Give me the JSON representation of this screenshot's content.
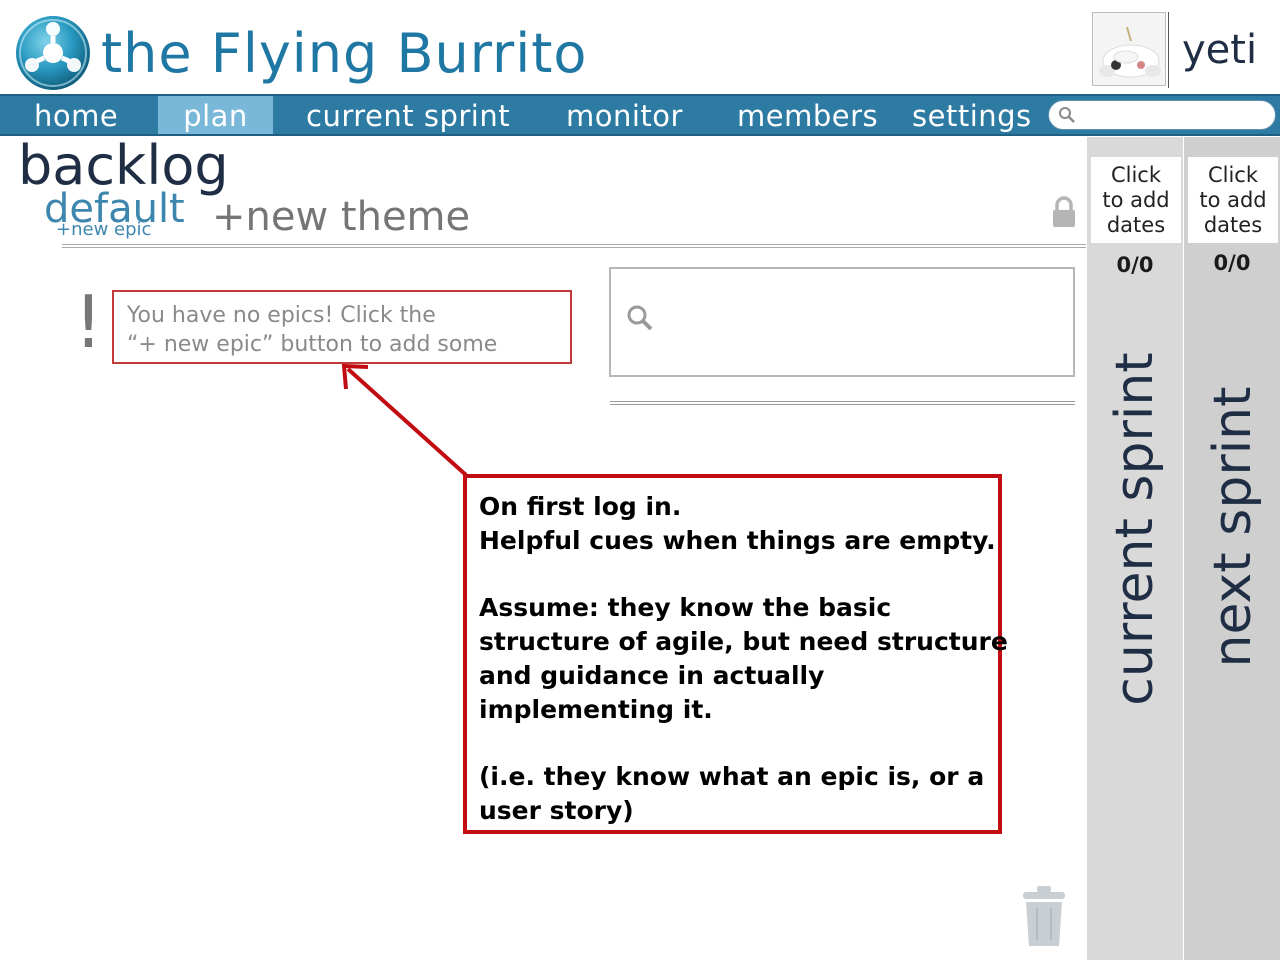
{
  "header": {
    "app_title": "the Flying Burrito",
    "username": "yeti"
  },
  "nav": {
    "items": [
      {
        "label": "home"
      },
      {
        "label": "plan",
        "active": true
      },
      {
        "label": "current sprint"
      },
      {
        "label": "monitor"
      },
      {
        "label": "members"
      },
      {
        "label": "settings"
      }
    ],
    "search_placeholder": ""
  },
  "backlog": {
    "title": "backlog",
    "tabs": [
      {
        "label": "default",
        "active": true
      }
    ],
    "new_epic_label": "+new epic",
    "new_theme_label": "+new theme",
    "empty_marker": "!",
    "empty_message": "You have no epics! Click the\n“+ new epic”  button to add some",
    "search_placeholder": ""
  },
  "annotation": {
    "lines": [
      "On first log in.",
      "Helpful cues when things are empty.",
      "",
      "Assume: they know the basic",
      "structure of agile, but need structure",
      "and guidance in actually",
      "implementing it.",
      "",
      "(i.e. they know what an epic is, or a",
      "user story)"
    ]
  },
  "sprints": [
    {
      "label": "current sprint",
      "dates_label": "Click\nto add\ndates",
      "points": "0/0"
    },
    {
      "label": "next sprint",
      "dates_label": "Click\nto add\ndates",
      "points": "0/0"
    }
  ],
  "colors": {
    "brand": "#1f78a3",
    "nav_bg": "#2d7aa3",
    "nav_active": "#79b8d8",
    "annotation_border": "#c10d12",
    "notice_border": "#c23a3a"
  }
}
